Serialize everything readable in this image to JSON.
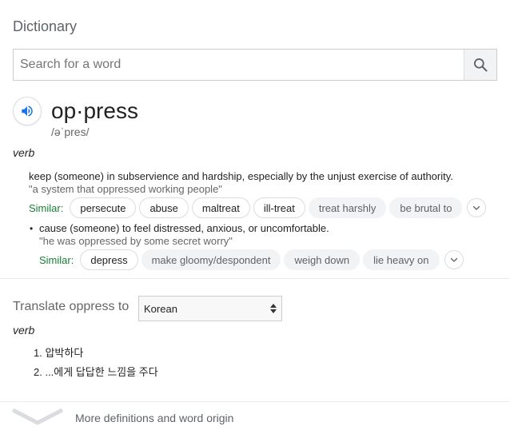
{
  "header": {
    "title": "Dictionary"
  },
  "search": {
    "placeholder": "Search for a word",
    "value": ""
  },
  "entry": {
    "word": "op·press",
    "phonetic": "/əˈpres/",
    "part_of_speech": "verb",
    "definitions": [
      {
        "text": "keep (someone) in subservience and hardship, especially by the unjust exercise of authority.",
        "example": "\"a system that oppressed working people\"",
        "similar_label": "Similar:",
        "similar": [
          "persecute",
          "abuse",
          "maltreat",
          "ill-treat",
          "treat harshly",
          "be brutal to"
        ]
      },
      {
        "bullet": "•",
        "text": "cause (someone) to feel distressed, anxious, or uncomfortable.",
        "example": "\"he was oppressed by some secret worry\"",
        "similar_label": "Similar:",
        "similar": [
          "depress",
          "make gloomy/despondent",
          "weigh down",
          "lie heavy on"
        ]
      }
    ]
  },
  "translate": {
    "label": "Translate oppress to",
    "language": "Korean",
    "part_of_speech": "verb",
    "items": [
      "1. 압박하다",
      "2. ...에게 답답한 느낌을 주다"
    ]
  },
  "footer": {
    "more_label": "More definitions and word origin"
  },
  "icons": {
    "search": "search-icon",
    "speaker": "speaker-icon",
    "expand": "chevron-down-icon",
    "select": "select-arrows-icon",
    "more": "chevron-down-icon"
  },
  "colors": {
    "accent": "#1a73e8",
    "similar_label": "#188038",
    "muted": "#5f6368"
  }
}
